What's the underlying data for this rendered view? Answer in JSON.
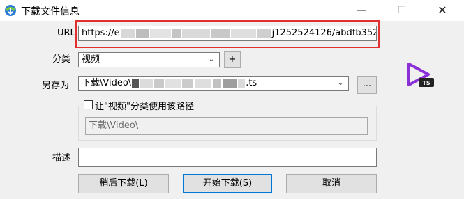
{
  "window": {
    "title": "下载文件信息",
    "minimize_glyph": "—",
    "maximize_glyph": "☐",
    "close_glyph": "✕"
  },
  "url": {
    "label": "URL",
    "value_start": "https://e",
    "value_end": "j1252524126/abdfb352"
  },
  "category": {
    "label": "分类",
    "selected": "视频",
    "add_label": "+"
  },
  "save_as": {
    "label": "另存为",
    "value_start": "下载\\Video\\",
    "value_end": ".ts",
    "browse_label": "..."
  },
  "use_path": {
    "label": "让\"视频\"分类使用该路径",
    "checked": false,
    "path_value": "下载\\Video\\"
  },
  "description": {
    "label": "描述",
    "value": ""
  },
  "buttons": {
    "later": "稍后下载(L)",
    "start": "开始下载(S)",
    "cancel": "取消"
  },
  "icons": {
    "app": "idm-icon",
    "file_type": "ts-video-icon",
    "file_type_badge": "TS",
    "accent": "#8b2fd6",
    "highlight": "#e03030"
  }
}
